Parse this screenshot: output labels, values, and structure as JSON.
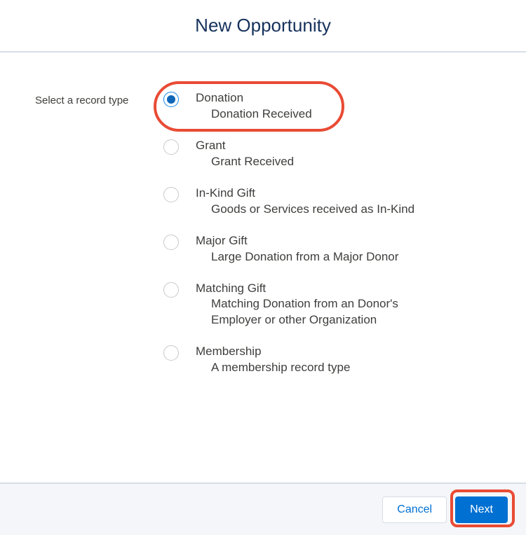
{
  "header": {
    "title": "New Opportunity"
  },
  "form": {
    "label": "Select a record type",
    "options": [
      {
        "label": "Donation",
        "desc": "Donation Received",
        "selected": true
      },
      {
        "label": "Grant",
        "desc": "Grant Received",
        "selected": false
      },
      {
        "label": "In-Kind Gift",
        "desc": "Goods or Services received as In-Kind",
        "selected": false
      },
      {
        "label": "Major Gift",
        "desc": "Large Donation from a Major Donor",
        "selected": false
      },
      {
        "label": "Matching Gift",
        "desc": "Matching Donation from an Donor's Employer or other Organization",
        "selected": false
      },
      {
        "label": "Membership",
        "desc": "A membership record type",
        "selected": false
      }
    ]
  },
  "footer": {
    "cancel": "Cancel",
    "next": "Next"
  },
  "highlights": {
    "option_index": 0,
    "next_button": true
  }
}
